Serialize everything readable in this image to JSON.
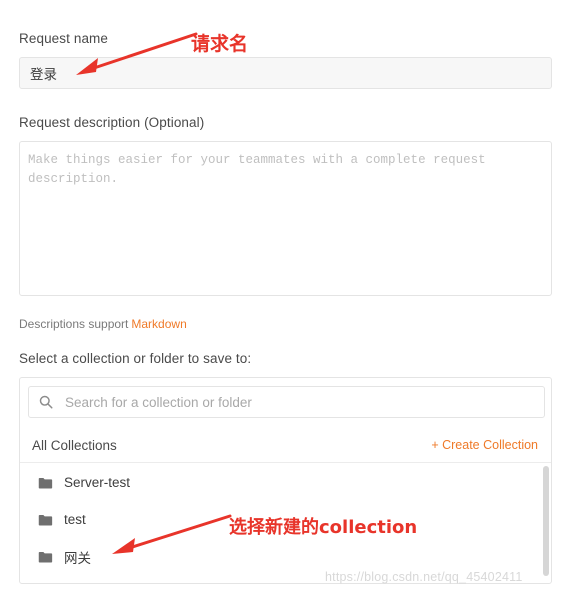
{
  "form": {
    "request_name_label": "Request name",
    "request_name_value": "登录",
    "request_description_label": "Request description (Optional)",
    "request_description_placeholder": "Make things easier for your teammates with a complete request description.",
    "description_support_text": "Descriptions support",
    "markdown_link": "Markdown",
    "select_collection_label": "Select a collection or folder to save to:"
  },
  "picker": {
    "search_placeholder": "Search for a collection or folder",
    "search_value": "",
    "all_collections_label": "All Collections",
    "create_collection_label": "+ Create Collection",
    "items": [
      {
        "label": "Server-test",
        "icon": "folder-icon"
      },
      {
        "label": "test",
        "icon": "folder-icon"
      },
      {
        "label": "网关",
        "icon": "folder-icon"
      }
    ]
  },
  "annotations": [
    {
      "text": "请求名"
    },
    {
      "text": "选择新建的collection"
    }
  ],
  "watermark": "https://blog.csdn.net/qq_45402411",
  "colors": {
    "accent": "#ef7a29",
    "annotation": "#e8342a",
    "folder": "#6b6b6b",
    "border": "#e4e4e4"
  }
}
